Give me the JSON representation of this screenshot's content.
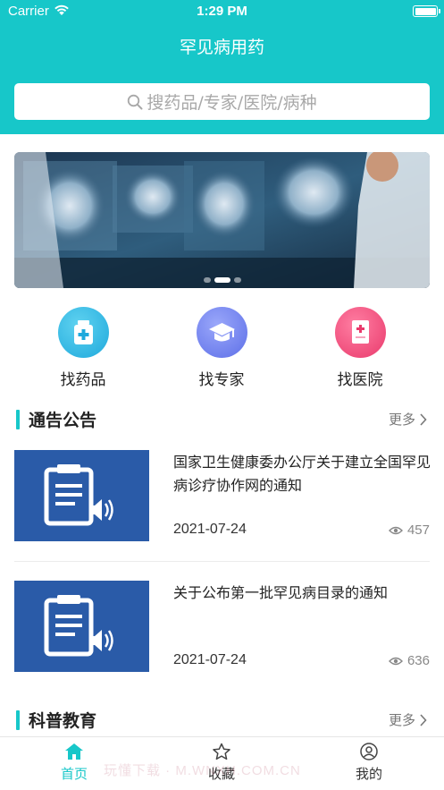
{
  "status_bar": {
    "carrier": "Carrier",
    "time": "1:29 PM"
  },
  "header": {
    "title": "罕见病用药"
  },
  "search": {
    "placeholder": "搜药品/专家/医院/病种"
  },
  "banner": {
    "pages": 3,
    "active_page": 2
  },
  "quick_links": [
    {
      "label": "找药品",
      "icon": "medicine-box-icon",
      "color": "#2bb7e4"
    },
    {
      "label": "找专家",
      "icon": "graduation-cap-icon",
      "color": "#6b7df0"
    },
    {
      "label": "找医院",
      "icon": "hospital-document-icon",
      "color": "#ee4d7c"
    }
  ],
  "notices": {
    "title": "通告公告",
    "more": "更多",
    "items": [
      {
        "title": "国家卫生健康委办公厅关于建立全国罕见病诊疗协作网的通知",
        "date": "2021-07-24",
        "views": "457"
      },
      {
        "title": "关于公布第一批罕见病目录的通知",
        "date": "2021-07-24",
        "views": "636"
      }
    ]
  },
  "education": {
    "title": "科普教育",
    "more": "更多"
  },
  "tabbar": {
    "tabs": [
      {
        "label": "首页",
        "icon": "home-icon",
        "active": true
      },
      {
        "label": "收藏",
        "icon": "star-icon",
        "active": false
      },
      {
        "label": "我的",
        "icon": "user-icon",
        "active": false
      }
    ]
  },
  "watermark": "玩懂下载 · M.WNXH.COM.CN",
  "colors": {
    "accent": "#17c7c9",
    "thumb": "#2a5ba8"
  }
}
